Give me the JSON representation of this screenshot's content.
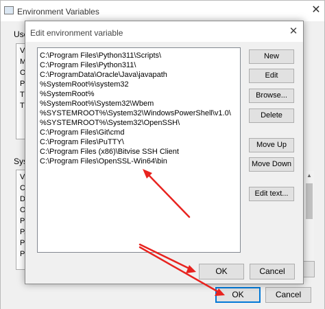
{
  "env_window": {
    "title": "Environment Variables",
    "close_glyph": "✕",
    "user_group_label": "User",
    "system_group_label": "Syste",
    "user_fragments": [
      "Va",
      "M",
      "Or",
      "Pa",
      "TE",
      "TM"
    ],
    "system_fragments": [
      "Va",
      "Co",
      "Dr",
      "OS",
      "Pa",
      "PA",
      "PR",
      "PR"
    ],
    "ok_label": "OK",
    "cancel_label": "Cancel"
  },
  "edit_dialog": {
    "title": "Edit environment variable",
    "close_glyph": "✕",
    "paths": [
      "C:\\Program Files\\Python311\\Scripts\\",
      "C:\\Program Files\\Python311\\",
      "C:\\ProgramData\\Oracle\\Java\\javapath",
      "%SystemRoot%\\system32",
      "%SystemRoot%",
      "%SystemRoot%\\System32\\Wbem",
      "%SYSTEMROOT%\\System32\\WindowsPowerShell\\v1.0\\",
      "%SYSTEMROOT%\\System32\\OpenSSH\\",
      "C:\\Program Files\\Git\\cmd",
      "C:\\Program Files\\PuTTY\\",
      "C:\\Program Files (x86)\\Bitvise SSH Client",
      "C:\\Program Files\\OpenSSL-Win64\\bin"
    ],
    "buttons": {
      "new": "New",
      "edit": "Edit",
      "browse": "Browse...",
      "delete": "Delete",
      "move_up": "Move Up",
      "move_down": "Move Down",
      "edit_text": "Edit text..."
    },
    "ok_label": "OK",
    "cancel_label": "Cancel"
  },
  "colors": {
    "annotation_arrow": "#e8231f",
    "focus_border": "#0078d7"
  }
}
